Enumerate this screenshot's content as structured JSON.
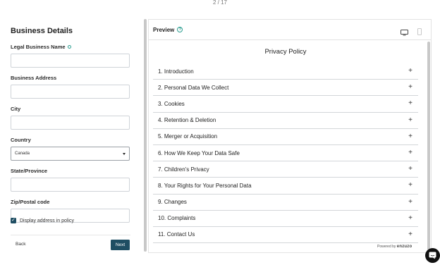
{
  "header": {
    "page_counter": "2 / 17"
  },
  "form": {
    "title": "Business Details",
    "fields": [
      {
        "label": "Legal Business Name",
        "value": "",
        "has_info": true
      },
      {
        "label": "Business Address",
        "value": ""
      },
      {
        "label": "City",
        "value": ""
      }
    ],
    "country": {
      "label": "Country",
      "selected": "Canada"
    },
    "fields2": [
      {
        "label": "State/Province",
        "value": ""
      },
      {
        "label": "Zip/Postal code",
        "value": ""
      }
    ],
    "display_address": {
      "label": "Display address in policy",
      "checked": true
    },
    "back_label": "Back",
    "next_label": "Next"
  },
  "preview": {
    "title": "Preview",
    "help_symbol": "?",
    "policy_title": "Privacy Policy",
    "sections": [
      "1. Introduction",
      "2. Personal Data We Collect",
      "3. Cookies",
      "4. Retention & Deletion",
      "5. Merger or Acquisition",
      "6. How We Keep Your Data Safe",
      "7. Children's Privacy",
      "8. Your Rights for Your Personal Data",
      "9. Changes",
      "10. Complaints",
      "11. Contact Us"
    ],
    "expand_symbol": "+",
    "powered_by": "Powered by",
    "brand": "enzuzo"
  },
  "colors": {
    "accent": "#1f4e63",
    "help": "#2a9d8f"
  }
}
